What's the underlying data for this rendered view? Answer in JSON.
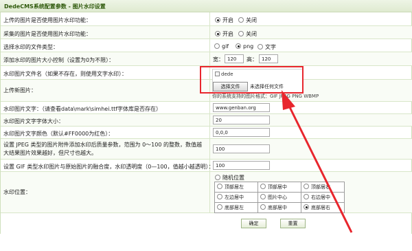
{
  "title": "DedeCMS系统配置参数 - 图片水印设置",
  "rows": {
    "upload_watermark": {
      "label": "上传的图片是否使用图片水印功能：",
      "opt_on": "开启",
      "opt_off": "关闭",
      "value": "开启"
    },
    "collect_watermark": {
      "label": "采集的图片是否使用图片水印功能：",
      "opt_on": "开启",
      "opt_off": "关闭",
      "value": "开启"
    },
    "file_type": {
      "label": "选择水印的文件类型：",
      "options": [
        "gif",
        "png",
        "文字"
      ],
      "value": "png"
    },
    "min_size": {
      "label": "添加水印的图片大小控制（设置为0为不限）：",
      "width_label": "宽：",
      "width_value": "120",
      "height_label": "高：",
      "height_value": "120"
    },
    "file_name": {
      "label": "水印图片文件名（如果不存在，则使用文字水印）：",
      "image_alt": "dede"
    },
    "upload_new": {
      "label": "上传新图片：",
      "button": "选择文件",
      "no_file": "未选择任何文件",
      "hint": "你的系统支持的图片格式：GIF JPEG PNG WBMP"
    },
    "text": {
      "label": "水印图片文字：（请查看data\\mark\\simhei.ttf字体库是否存在）",
      "value": "www.genban.org"
    },
    "font_size": {
      "label": "水印图片文字字体大小：",
      "value": "20"
    },
    "font_color": {
      "label": "水印图片文字颜色（默认#FF0000为红色）：",
      "value": "0,0,0"
    },
    "jpeg_quality": {
      "label": "设置 JPEG 类型的图片附件添加水印后质量参数，范围为 0～100 的整数，数值越大结果图片效果越好，但尺寸也越大。",
      "value": "100"
    },
    "gif_transparency": {
      "label": "设置 GIF 类型水印图片与原始图片的融合度，水印透明度（0—100，值越小越透明）：",
      "value": "100"
    },
    "position": {
      "label": "水印位置：",
      "random_label": "随机位置",
      "grid": [
        [
          "顶部居左",
          "顶部居中",
          "顶部居右"
        ],
        [
          "左边居中",
          "图片中心",
          "右边居中"
        ],
        [
          "底部居左",
          "底部居中",
          "底部居右"
        ]
      ],
      "value": "底部居右"
    }
  },
  "buttons": {
    "confirm": "确定",
    "reset": "重置"
  },
  "colors": {
    "title_text": "#2f5a0c",
    "highlight": "#e8262d",
    "row_border": "#d8e6c8"
  }
}
